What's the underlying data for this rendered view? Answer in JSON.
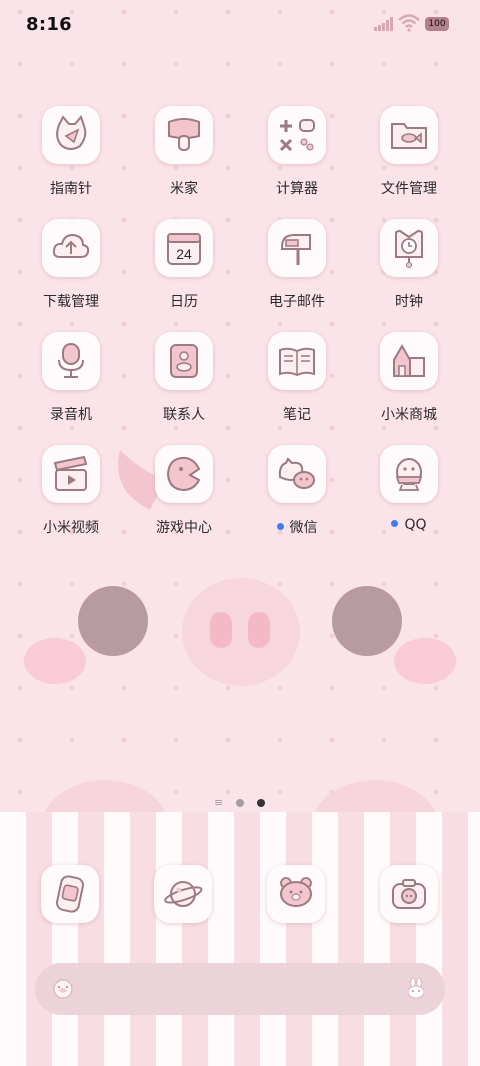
{
  "status_bar": {
    "time": "8:16",
    "battery_level": "100",
    "signal_icon": "signal-bars-icon",
    "wifi_icon": "wifi-icon"
  },
  "apps": [
    {
      "label": "指南针",
      "icon": "cat-compass-icon",
      "has_dot": false
    },
    {
      "label": "米家",
      "icon": "mushroom-home-icon",
      "has_dot": false
    },
    {
      "label": "计算器",
      "icon": "calculator-icon",
      "has_dot": false
    },
    {
      "label": "文件管理",
      "icon": "fish-folder-icon",
      "has_dot": false
    },
    {
      "label": "下载管理",
      "icon": "cloud-download-icon",
      "has_dot": false
    },
    {
      "label": "日历",
      "icon": "calendar-icon",
      "date": "24",
      "has_dot": false
    },
    {
      "label": "电子邮件",
      "icon": "mailbox-icon",
      "has_dot": false
    },
    {
      "label": "时钟",
      "icon": "clock-icon",
      "has_dot": false
    },
    {
      "label": "录音机",
      "icon": "microphone-icon",
      "has_dot": false
    },
    {
      "label": "联系人",
      "icon": "contacts-book-icon",
      "has_dot": false
    },
    {
      "label": "笔记",
      "icon": "notebook-icon",
      "has_dot": false
    },
    {
      "label": "小米商城",
      "icon": "shop-house-icon",
      "has_dot": false
    },
    {
      "label": "小米视频",
      "icon": "clapperboard-icon",
      "has_dot": false
    },
    {
      "label": "游戏中心",
      "icon": "game-face-icon",
      "has_dot": false
    },
    {
      "label": "微信",
      "icon": "wechat-cat-icon",
      "has_dot": true
    },
    {
      "label": "QQ",
      "icon": "penguin-icon",
      "has_dot": true
    }
  ],
  "pager": {
    "pages": 2,
    "active_page": 2
  },
  "dock": [
    {
      "icon": "phone-icon"
    },
    {
      "icon": "planet-browser-icon"
    },
    {
      "icon": "bear-messages-icon"
    },
    {
      "icon": "camera-icon"
    }
  ],
  "search_bar": {
    "left_icon": "pig-face-icon",
    "right_icon": "bunny-icon"
  },
  "colors": {
    "wallpaper": "#fbe4e9",
    "tile": "#fffafc",
    "icon_stroke": "#9c7a82",
    "dot": "#3b7cf6",
    "search_bar": "#ecd3d9"
  }
}
